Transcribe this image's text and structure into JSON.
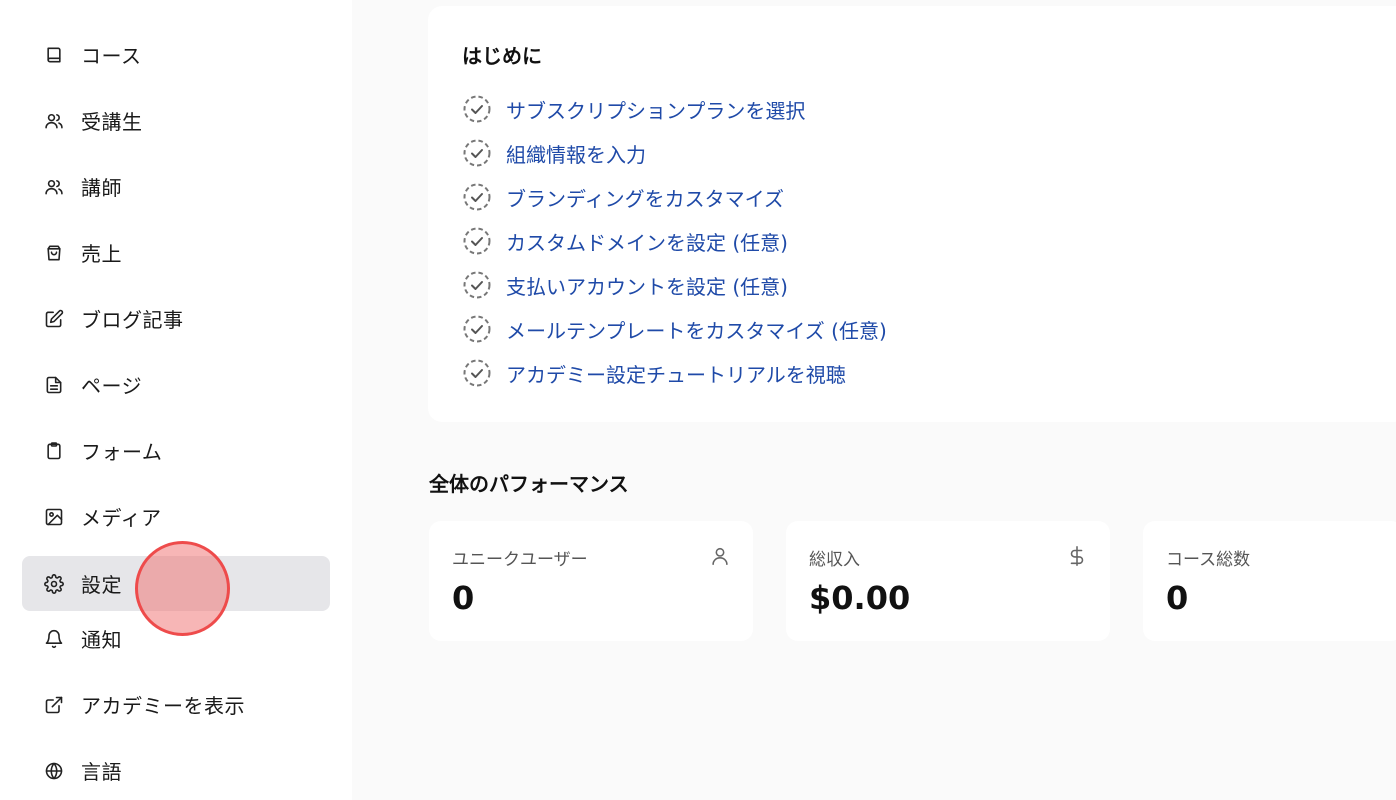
{
  "sidebar": {
    "items": [
      {
        "label": "コース",
        "icon": "book-icon"
      },
      {
        "label": "受講生",
        "icon": "users-icon"
      },
      {
        "label": "講師",
        "icon": "users-icon"
      },
      {
        "label": "売上",
        "icon": "shopping-bag-icon"
      },
      {
        "label": "ブログ記事",
        "icon": "edit-icon"
      },
      {
        "label": "ページ",
        "icon": "file-text-icon"
      },
      {
        "label": "フォーム",
        "icon": "clipboard-icon"
      },
      {
        "label": "メディア",
        "icon": "image-icon"
      },
      {
        "label": "設定",
        "icon": "gear-icon",
        "active": true
      },
      {
        "label": "通知",
        "icon": "bell-icon"
      },
      {
        "label": "アカデミーを表示",
        "icon": "external-link-icon"
      },
      {
        "label": "言語",
        "icon": "globe-icon"
      }
    ]
  },
  "getting_started": {
    "title": "はじめに",
    "tasks": [
      "サブスクリプションプランを選択",
      "組織情報を入力",
      "ブランディングをカスタマイズ",
      "カスタムドメインを設定 (任意)",
      "支払いアカウントを設定 (任意)",
      "メールテンプレートをカスタマイズ (任意)",
      "アカデミー設定チュートリアルを視聴"
    ]
  },
  "performance": {
    "title": "全体のパフォーマンス",
    "stats": [
      {
        "label": "ユニークユーザー",
        "value": "0",
        "icon": "user-icon"
      },
      {
        "label": "総収入",
        "value": "$0.00",
        "icon": "dollar-icon"
      },
      {
        "label": "コース総数",
        "value": "0",
        "icon": ""
      }
    ]
  },
  "colors": {
    "link": "#1f4aa8",
    "active_bg": "#e6e6e9",
    "click_marker": "#ee4b4b"
  }
}
